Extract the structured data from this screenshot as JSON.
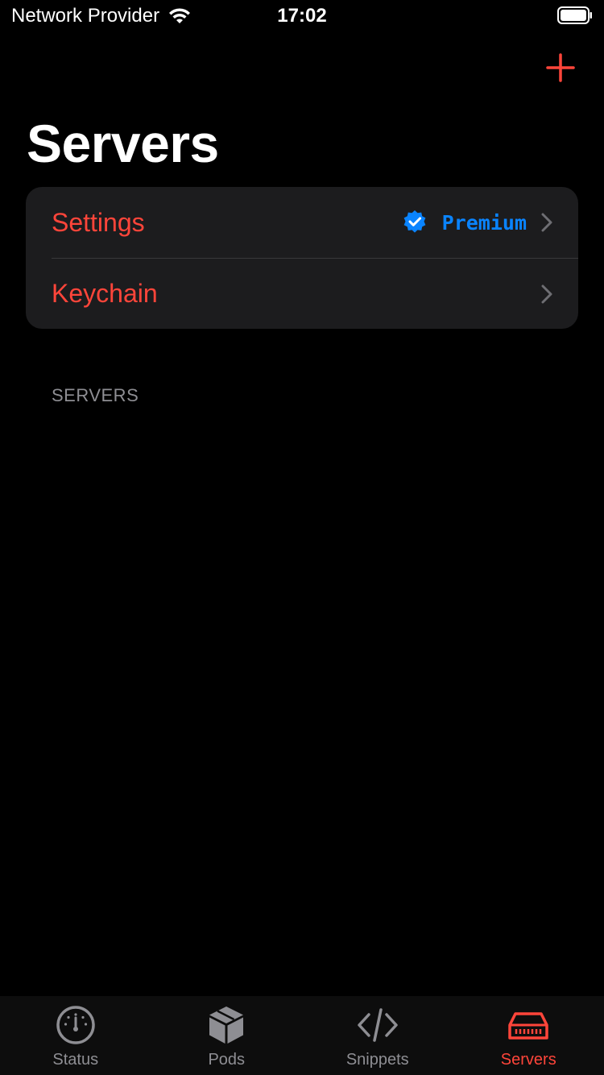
{
  "status_bar": {
    "carrier": "Network Provider",
    "time": "17:02"
  },
  "header": {
    "title": "Servers",
    "add_icon": "plus-icon"
  },
  "settings_group": {
    "settings_label": "Settings",
    "premium_label": "Premium",
    "premium_icon": "verified-badge-icon",
    "keychain_label": "Keychain"
  },
  "section": {
    "servers_header": "SERVERS"
  },
  "tab_bar": {
    "tabs": [
      {
        "label": "Status",
        "icon": "gauge-icon"
      },
      {
        "label": "Pods",
        "icon": "cube-icon"
      },
      {
        "label": "Snippets",
        "icon": "code-icon"
      },
      {
        "label": "Servers",
        "icon": "server-icon"
      }
    ],
    "active_index": 3
  },
  "colors": {
    "accent": "#ff453a",
    "premium": "#0a84ff",
    "inactive": "#8e8e93",
    "card": "#1c1c1e"
  }
}
